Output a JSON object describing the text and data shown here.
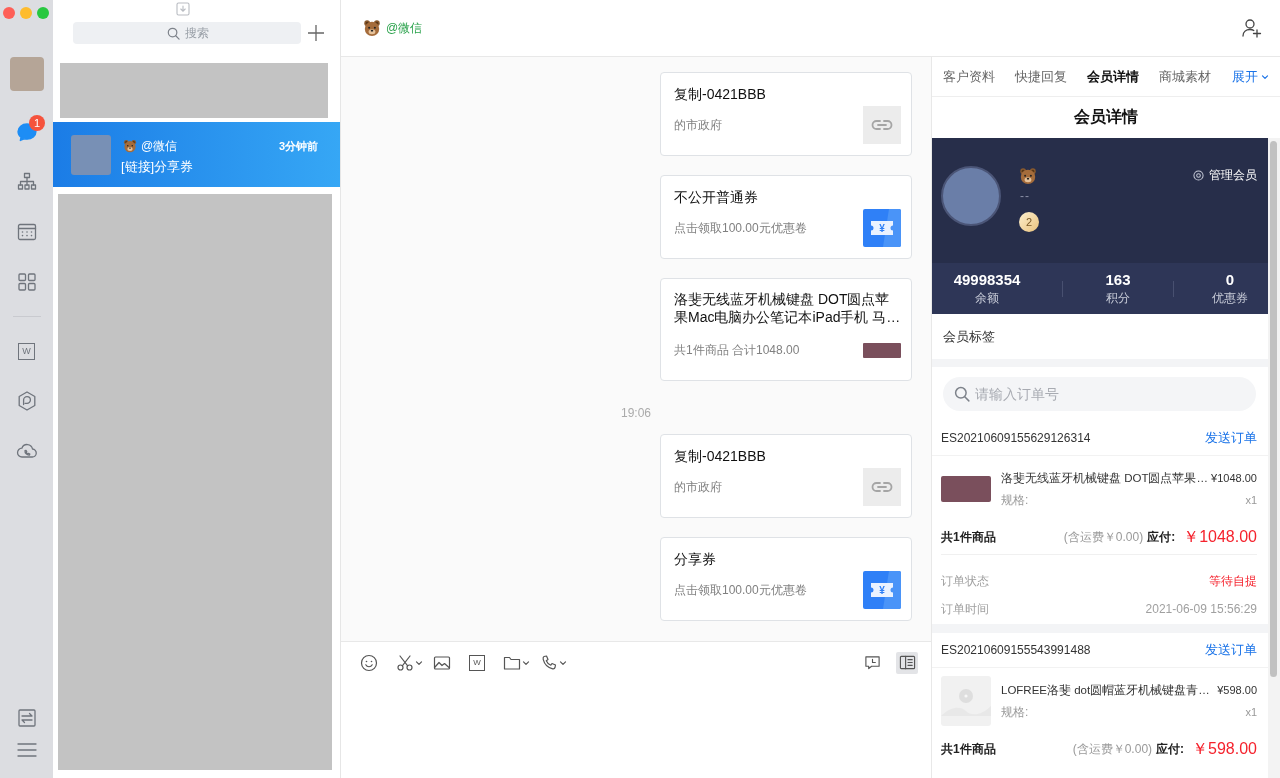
{
  "rail": {
    "groups": [
      {
        "items": [
          {
            "kind": "messages",
            "selected": true,
            "badge": "1"
          },
          {
            "kind": "org-chart",
            "selected": false
          },
          {
            "kind": "calendar",
            "selected": false
          },
          {
            "kind": "apps",
            "selected": false
          }
        ]
      },
      {
        "items": [
          {
            "kind": "document",
            "selected": false,
            "glyph": "W"
          },
          {
            "kind": "hexagon",
            "selected": false
          },
          {
            "kind": "cloud-call",
            "selected": false
          }
        ]
      }
    ],
    "bottom": [
      {
        "kind": "switch"
      },
      {
        "kind": "menu"
      }
    ]
  },
  "chat_list": {
    "search": {
      "placeholder": "搜索"
    },
    "items": [
      {
        "kind": "redacted",
        "selected": false
      },
      {
        "kind": "conversation",
        "selected": true,
        "name": "@微信",
        "time": "3分钟前",
        "preview": "[链接]分享券"
      },
      {
        "kind": "redacted",
        "selected": false
      }
    ]
  },
  "chat": {
    "header": {
      "name": "@微信"
    },
    "messages": [
      {
        "kind": "link",
        "title": "复制-0421BBB",
        "desc": "的市政府"
      },
      {
        "kind": "coupon",
        "title": "不公开普通券",
        "desc": "点击领取100.00元优惠卷",
        "icon_text": "¥"
      },
      {
        "kind": "product",
        "title": "洛斐无线蓝牙机械键盘 DOT圆点苹果Mac电脑办公笔记本iPad手机 马…",
        "desc": "共1件商品 合计1048.00"
      },
      {
        "kind": "time",
        "text": "19:06"
      },
      {
        "kind": "link",
        "title": "复制-0421BBB",
        "desc": "的市政府"
      },
      {
        "kind": "coupon",
        "title": "分享券",
        "desc": "点击领取100.00元优惠卷",
        "icon_text": "¥"
      }
    ],
    "toolbar": {
      "tools": [
        {
          "kind": "emoji",
          "dropdown": false
        },
        {
          "kind": "scissors",
          "dropdown": true
        },
        {
          "kind": "image",
          "dropdown": false
        },
        {
          "kind": "document",
          "dropdown": false,
          "glyph": "W"
        },
        {
          "kind": "folder",
          "dropdown": true
        },
        {
          "kind": "phone",
          "dropdown": true
        }
      ],
      "right_tools": [
        {
          "kind": "history",
          "selected": false
        },
        {
          "kind": "side-panel",
          "selected": true
        }
      ]
    }
  },
  "panel": {
    "tabs": [
      {
        "label": "客户资料",
        "selected": false
      },
      {
        "label": "快捷回复",
        "selected": false
      },
      {
        "label": "会员详情",
        "selected": true
      },
      {
        "label": "商城素材",
        "selected": false
      }
    ],
    "expand": "展开",
    "title": "会员详情",
    "member": {
      "subtitle": "--",
      "level": "2",
      "manage": "管理会员",
      "stats": [
        {
          "value": "49998354",
          "label": "余额"
        },
        {
          "value": "163",
          "label": "积分"
        },
        {
          "value": "0",
          "label": "优惠券"
        }
      ]
    },
    "tags_label": "会员标签",
    "order_search": {
      "placeholder": "请输入订单号"
    },
    "orders": [
      {
        "id": "ES20210609155629126314",
        "action": "发送订单",
        "product": {
          "kind": "photo",
          "title": "洛斐无线蓝牙机械键盘 DOT圆点苹果…",
          "price": "¥1048.00",
          "spec": "规格:",
          "quantity": "x1"
        },
        "count": "共1件商品",
        "shipping": "(含运费￥0.00)",
        "due_label": "应付:",
        "total": "￥1048.00",
        "details": [
          {
            "kind": "status",
            "label": "订单状态",
            "value": "等待自提"
          },
          {
            "kind": "plain",
            "label": "订单时间",
            "value": "2021-06-09 15:56:29"
          }
        ]
      },
      {
        "id": "ES20210609155543991488",
        "action": "发送订单",
        "product": {
          "kind": "placeholder",
          "title": "LOFREE洛斐 dot圆帽蓝牙机械键盘青…",
          "price": "¥598.00",
          "spec": "规格:",
          "quantity": "x1"
        },
        "count": "共1件商品",
        "shipping": "(含运费￥0.00)",
        "due_label": "应付:",
        "total": "￥598.00"
      }
    ]
  }
}
